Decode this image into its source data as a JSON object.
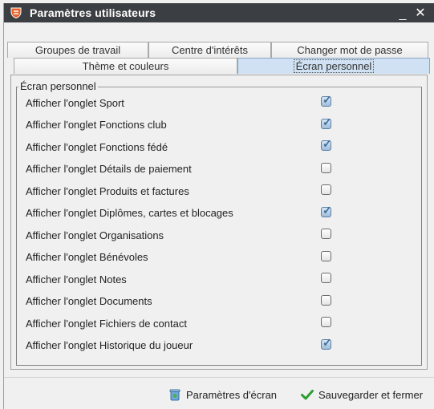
{
  "window": {
    "title": "Paramètres utilisateurs",
    "minimize_glyph": "_",
    "close_glyph": "✕"
  },
  "tabs": [
    {
      "label": "Groupes de travail"
    },
    {
      "label": "Centre d'intérêts"
    },
    {
      "label": "Changer mot de passe"
    },
    {
      "label": "Thème et couleurs"
    },
    {
      "label": "Écran personnel",
      "active": true
    }
  ],
  "group": {
    "legend": "Écran personnel",
    "options": [
      {
        "label": "Afficher l'onglet Sport",
        "checked": true
      },
      {
        "label": "Afficher l'onglet Fonctions club",
        "checked": true
      },
      {
        "label": "Afficher l'onglet Fonctions fédé",
        "checked": true
      },
      {
        "label": "Afficher l'onglet Détails de paiement",
        "checked": false
      },
      {
        "label": "Afficher l'onglet Produits et factures",
        "checked": false
      },
      {
        "label": "Afficher l'onglet Diplômes, cartes et blocages",
        "checked": true
      },
      {
        "label": "Afficher l'onglet Organisations",
        "checked": false
      },
      {
        "label": "Afficher l'onglet Bénévoles",
        "checked": false
      },
      {
        "label": "Afficher l'onglet Notes",
        "checked": false
      },
      {
        "label": "Afficher l'onglet Documents",
        "checked": false
      },
      {
        "label": "Afficher l'onglet Fichiers de contact",
        "checked": false
      },
      {
        "label": "Afficher l'onglet Historique du joueur",
        "checked": true
      }
    ]
  },
  "footer": {
    "screen_settings_label": "Paramètres d'écran",
    "save_close_label": "Sauvegarder et fermer"
  },
  "colors": {
    "titlebar": "#3b3e42",
    "active_tab": "#cfe1f2",
    "check_accent": "#3f6f9e",
    "save_icon": "#2e9d2e"
  }
}
